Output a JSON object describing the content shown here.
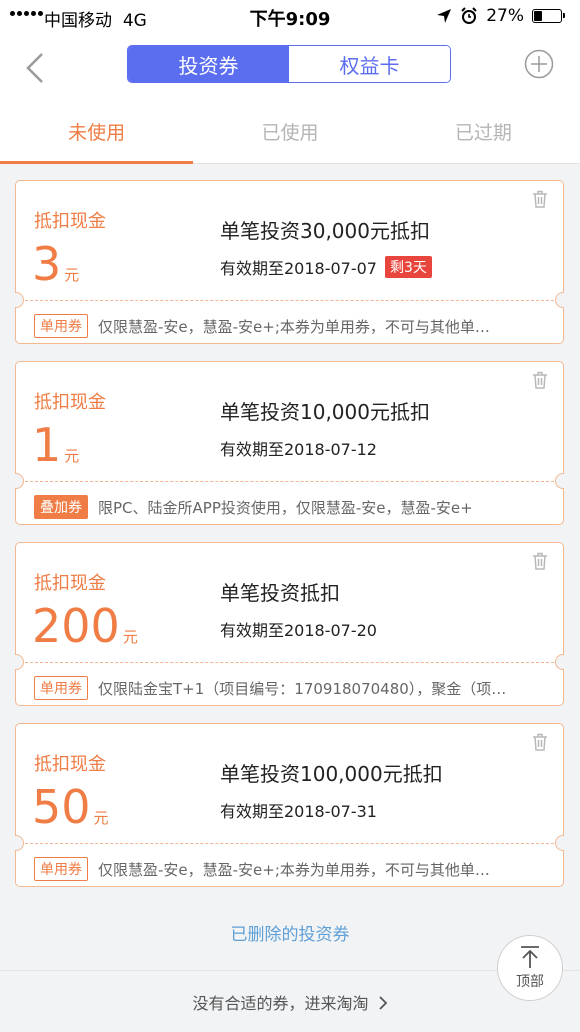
{
  "status_bar": {
    "carrier": "中国移动",
    "network": "4G",
    "time": "下午9:09",
    "battery": "27%"
  },
  "header": {
    "segments": [
      {
        "label": "投资券"
      },
      {
        "label": "权益卡"
      }
    ]
  },
  "tabs": [
    {
      "label": "未使用"
    },
    {
      "label": "已使用"
    },
    {
      "label": "已过期"
    }
  ],
  "coupons": [
    {
      "label": "抵扣现金",
      "amount": "3",
      "unit": "元",
      "title": "单笔投资30,000元抵扣",
      "expiry": "有效期至2018-07-07",
      "remaining": "剩3天",
      "tag": "单用券",
      "tag_style": "outline",
      "description": "仅限慧盈-安e，慧盈-安e+;本券为单用券，不可与其他单…"
    },
    {
      "label": "抵扣现金",
      "amount": "1",
      "unit": "元",
      "title": "单笔投资10,000元抵扣",
      "expiry": "有效期至2018-07-12",
      "tag": "叠加券",
      "tag_style": "filled",
      "description": "限PC、陆金所APP投资使用，仅限慧盈-安e，慧盈-安e+"
    },
    {
      "label": "抵扣现金",
      "amount": "200",
      "unit": "元",
      "title": "单笔投资抵扣",
      "expiry": "有效期至2018-07-20",
      "tag": "单用券",
      "tag_style": "outline",
      "description": "仅限陆金宝T+1（项目编号：170918070480），聚金（项…"
    },
    {
      "label": "抵扣现金",
      "amount": "50",
      "unit": "元",
      "title": "单笔投资100,000元抵扣",
      "expiry": "有效期至2018-07-31",
      "tag": "单用券",
      "tag_style": "outline",
      "description": "仅限慧盈-安e，慧盈-安e+;本券为单用券，不可与其他单…"
    }
  ],
  "deleted_link": "已删除的投资券",
  "to_top": "顶部",
  "footer_link": "没有合适的券，进来淘淘",
  "colors": {
    "accent": "#ef7d45",
    "segment": "#5b6ef0",
    "badge": "#e8453c",
    "link": "#5fa0d6"
  }
}
